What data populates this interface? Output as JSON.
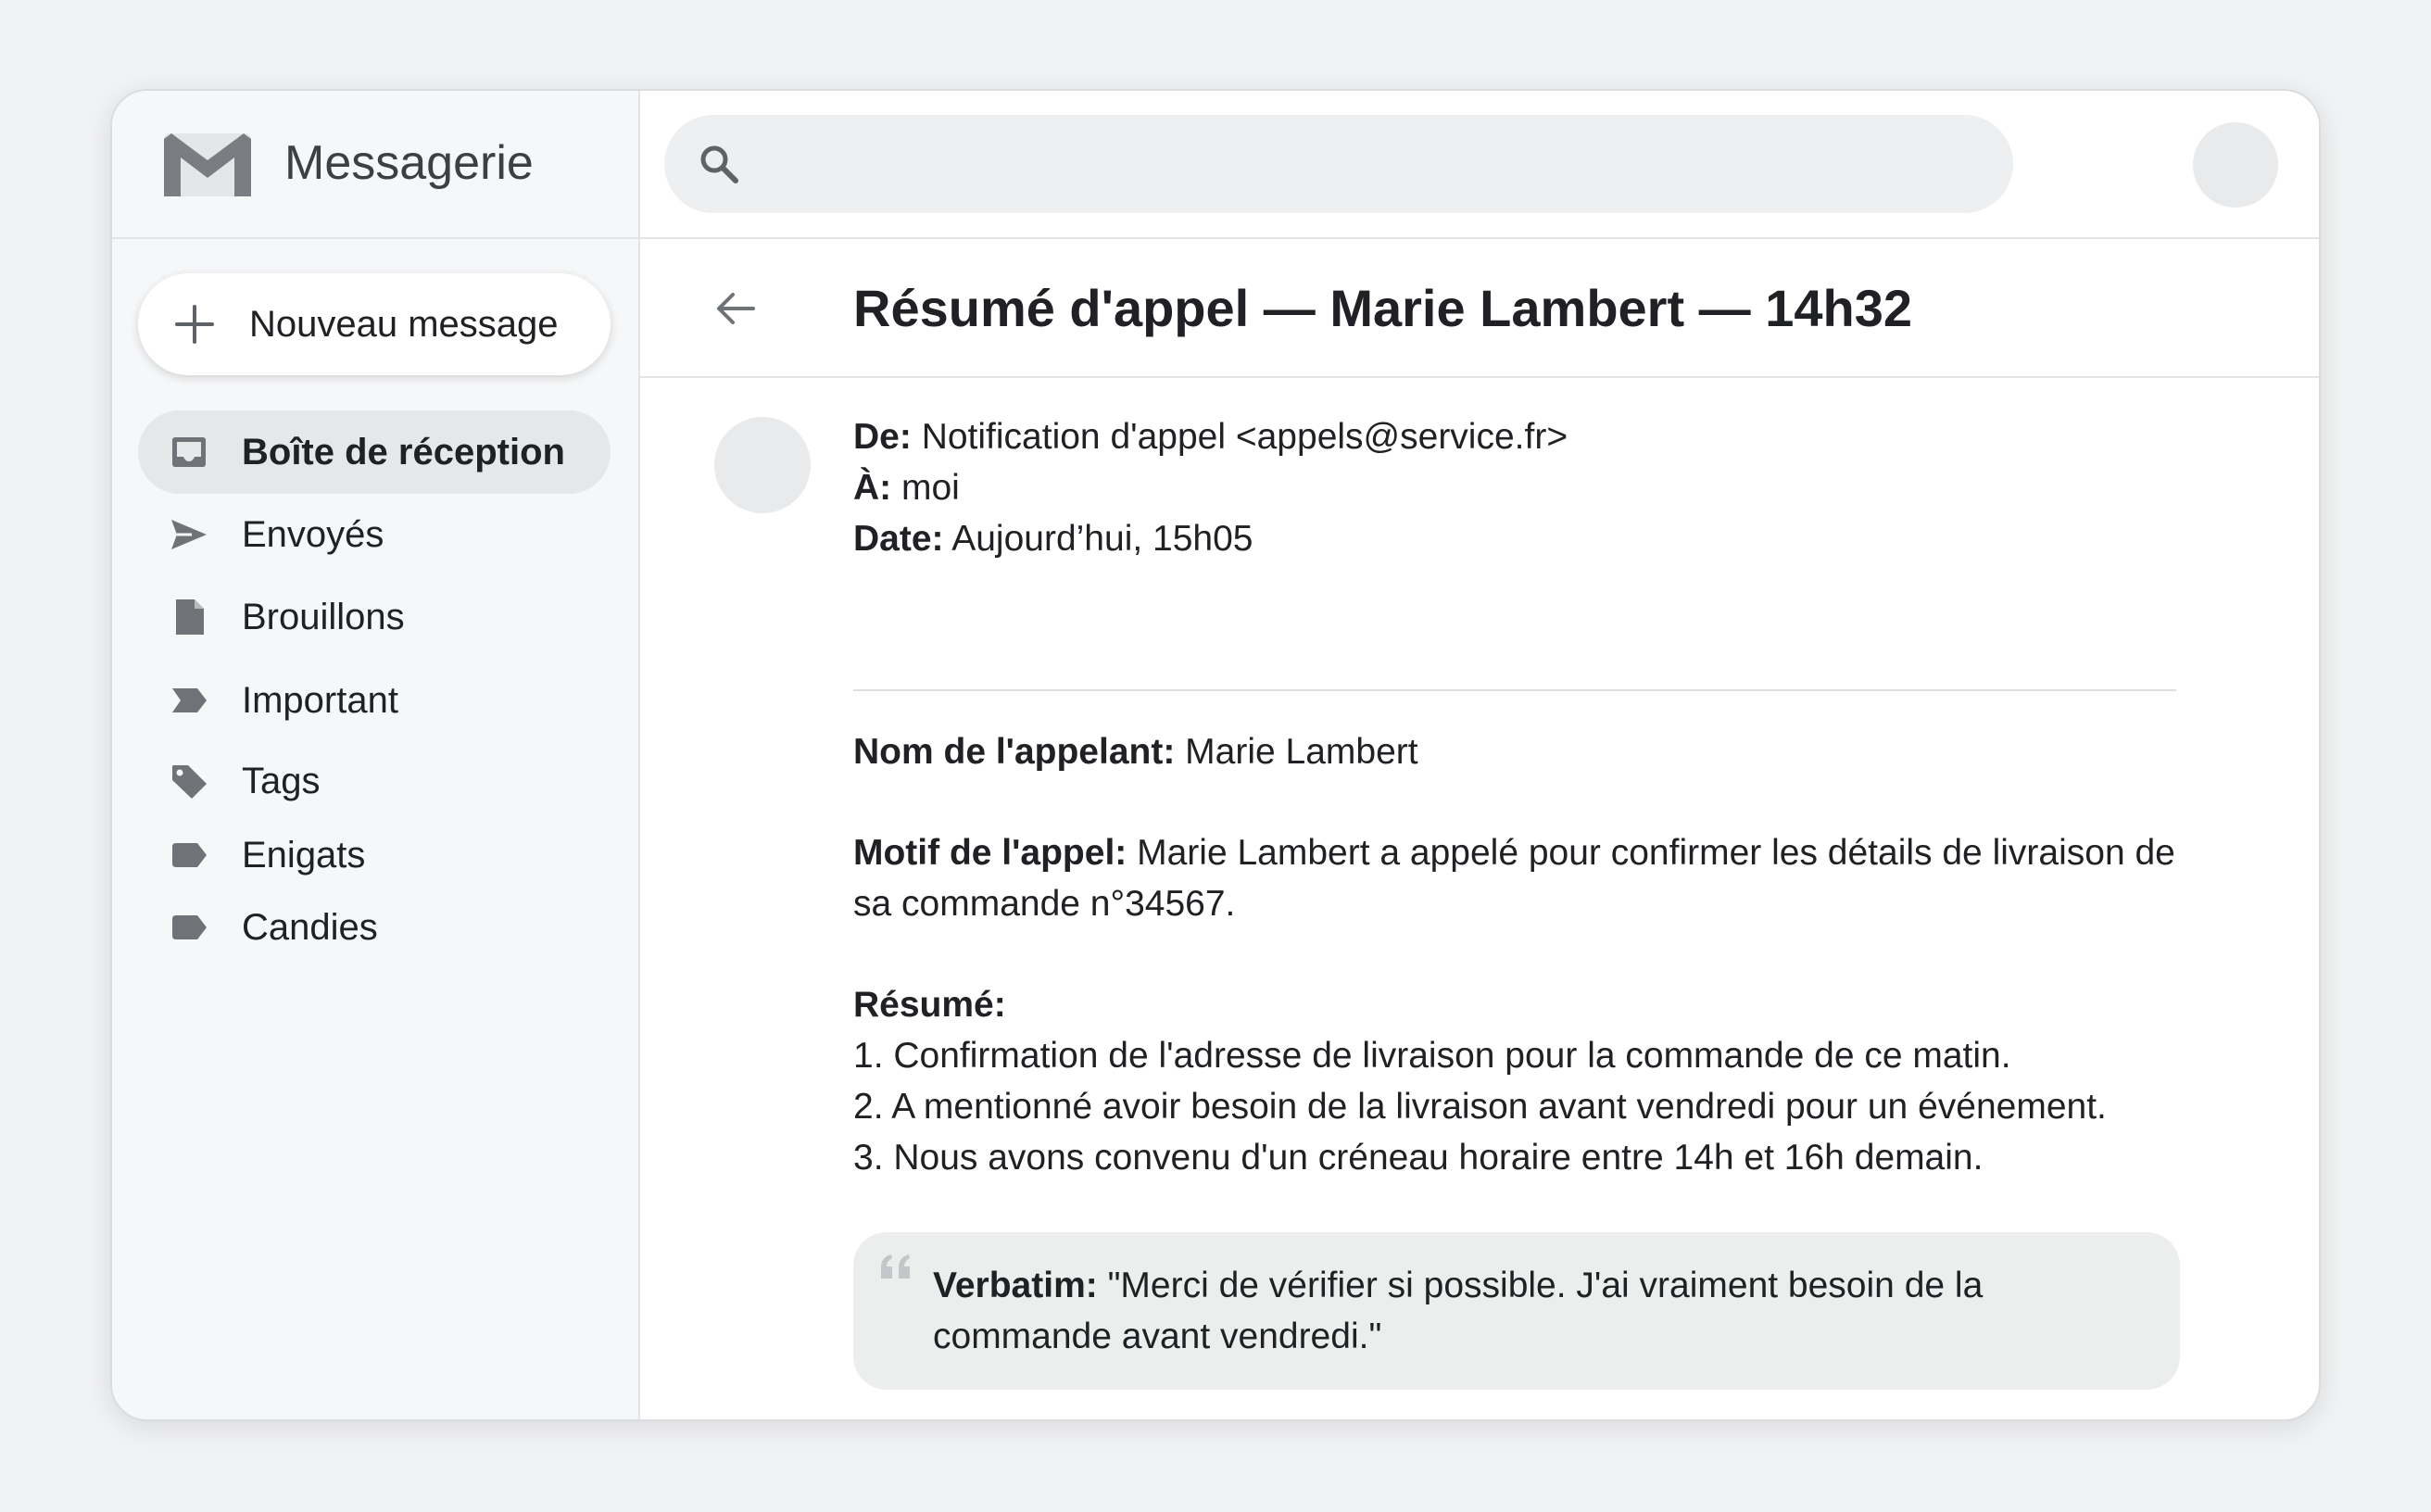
{
  "app": {
    "name": "Messagerie",
    "logo_icon": "mail-m-logo-icon"
  },
  "compose": {
    "label": "Nouveau message",
    "icon": "plus-icon"
  },
  "sidebar": {
    "items": [
      {
        "label": "Boîte de réception",
        "icon": "inbox-icon",
        "active": true
      },
      {
        "label": "Envoyés",
        "icon": "send-icon"
      },
      {
        "label": "Brouillons",
        "icon": "draft-icon"
      },
      {
        "label": "Important",
        "icon": "important-icon"
      },
      {
        "label": "Tags",
        "icon": "tag-icon"
      },
      {
        "label": "Enigats",
        "icon": "label-icon"
      },
      {
        "label": "Candies",
        "icon": "label-icon"
      }
    ]
  },
  "search": {
    "value": "",
    "placeholder": "",
    "icon": "search-icon"
  },
  "email": {
    "subject": "Résumé d'appel — Marie Lambert — 14h32",
    "from_label": "De:",
    "from_value": "Notification d'appel <appels@service.fr>",
    "to_label": "À:",
    "to_value": "moi",
    "date_label": "Date:",
    "date_value": "Aujourd’hui, 15h05",
    "caller_label": "Nom de l'appelant:",
    "caller_value": "Marie Lambert",
    "reason_label": "Motif de l'appel:",
    "reason_value": "Marie Lambert a appelé pour confirmer les détails de livraison de sa commande n°34567.",
    "summary_label": "Résumé:",
    "summary_items": [
      "1. Confirmation de l'adresse de livraison pour la commande de ce matin.",
      "2. A mentionné avoir besoin de la livraison avant vendredi pour un événement.",
      "3. Nous avons convenu d'un créneau horaire entre 14h et 16h demain."
    ],
    "verbatim_label": "Verbatim:",
    "verbatim_value": "\"Merci de vérifier si possible. J'ai vraiment besoin de la commande avant vendredi.\""
  },
  "colors": {
    "background": "#f1f2f3",
    "sidebar": "#f6f7f8",
    "active_item": "#e6e7e8",
    "icon": "#6f7276",
    "text": "#202124",
    "quote_bg": "#eceded"
  }
}
